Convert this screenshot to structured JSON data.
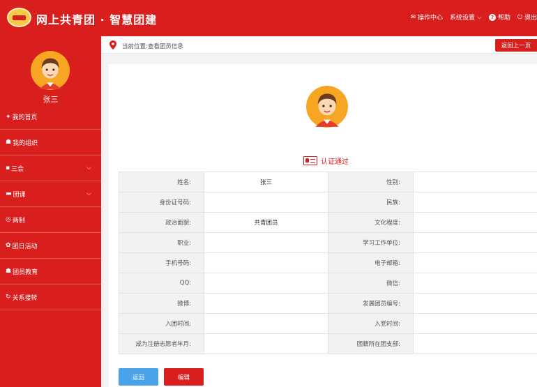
{
  "header": {
    "title": "网上共青团 · 智慧团建",
    "nav": [
      {
        "icon": "mail-icon",
        "glyph": "✉",
        "label": "操作中心"
      },
      {
        "icon": "none",
        "glyph": "",
        "label": "系统设置"
      },
      {
        "icon": "help-icon",
        "glyph": "?",
        "label": "帮助"
      },
      {
        "icon": "power-icon",
        "glyph": "⏻",
        "label": "退出"
      }
    ],
    "settings_chevron": "⌵"
  },
  "sidebar": {
    "username": "张三",
    "items": [
      {
        "glyph": "✦",
        "label": "我的首页"
      },
      {
        "glyph": "☗",
        "label": "我的组织"
      },
      {
        "glyph": "▪",
        "label": "三会"
      },
      {
        "glyph": "▬",
        "label": "团课"
      },
      {
        "glyph": "◎",
        "label": "两制"
      },
      {
        "glyph": "✿",
        "label": "团日活动"
      },
      {
        "glyph": "☗",
        "label": "团员教育"
      },
      {
        "glyph": "↻",
        "label": "关系接转"
      }
    ]
  },
  "breadcrumb": {
    "text": "当前位置:查看团员信息",
    "back_top_label": "返回上一页"
  },
  "profile": {
    "status": "认证通过",
    "rows": [
      [
        "姓名:",
        "张三",
        "性别:",
        ""
      ],
      [
        "身份证号码:",
        "",
        "民族:",
        ""
      ],
      [
        "政治面貌:",
        "共青团员",
        "文化程度:",
        ""
      ],
      [
        "职业:",
        "",
        "学习工作单位:",
        ""
      ],
      [
        "手机号码:",
        "",
        "电子邮箱:",
        ""
      ],
      [
        "QQ:",
        "",
        "微信:",
        ""
      ],
      [
        "微博:",
        "",
        "发展团员编号:",
        ""
      ],
      [
        "入团时间:",
        "",
        "入党时间:",
        ""
      ],
      [
        "成为注册志愿者年月:",
        "",
        "团籍所在团支部:",
        ""
      ]
    ]
  },
  "actions": {
    "back_label": "返回",
    "edit_label": "编辑"
  },
  "colors": {
    "brand_red": "#d91e1e",
    "button_blue": "#4aa3e8"
  }
}
